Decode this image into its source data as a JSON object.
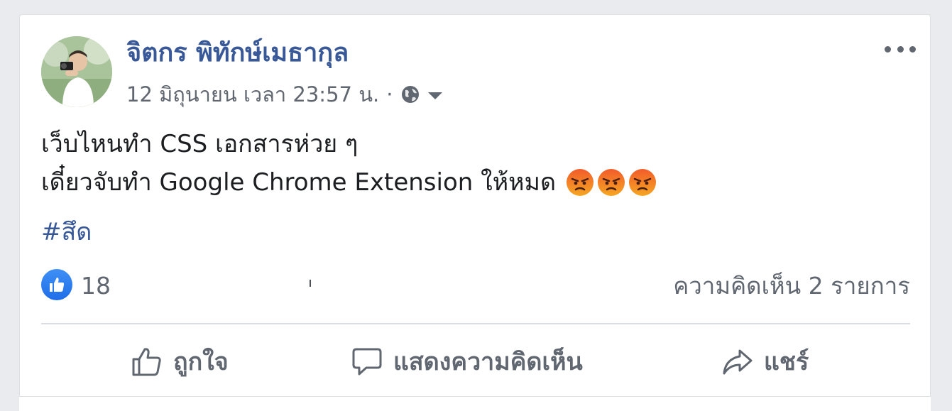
{
  "post": {
    "author": "จิตกร พิทักษ์เมธากุล",
    "timestamp": "12 มิถุนายน เวลา 23:57 น.",
    "separator": "·",
    "privacy_icon": "globe-icon",
    "body_lines": [
      "เว็บไหนทำ CSS เอกสารห่วย ๆ",
      "เดี๋ยวจับทำ Google Chrome Extension ให้หมด"
    ],
    "emoji": [
      "angry-face-icon",
      "angry-face-icon",
      "angry-face-icon"
    ],
    "hashtag": "#สึด"
  },
  "stats": {
    "like_count": "18",
    "comments": "ความคิดเห็น 2 รายการ"
  },
  "actions": {
    "like": "ถูกใจ",
    "comment": "แสดงความคิดเห็น",
    "share": "แชร์"
  },
  "colors": {
    "link": "#385898",
    "text": "#1c1e21",
    "muted": "#606770",
    "like_blue": "#1f6ee8",
    "angry": "#f0531c",
    "background": "#e9ebee"
  }
}
